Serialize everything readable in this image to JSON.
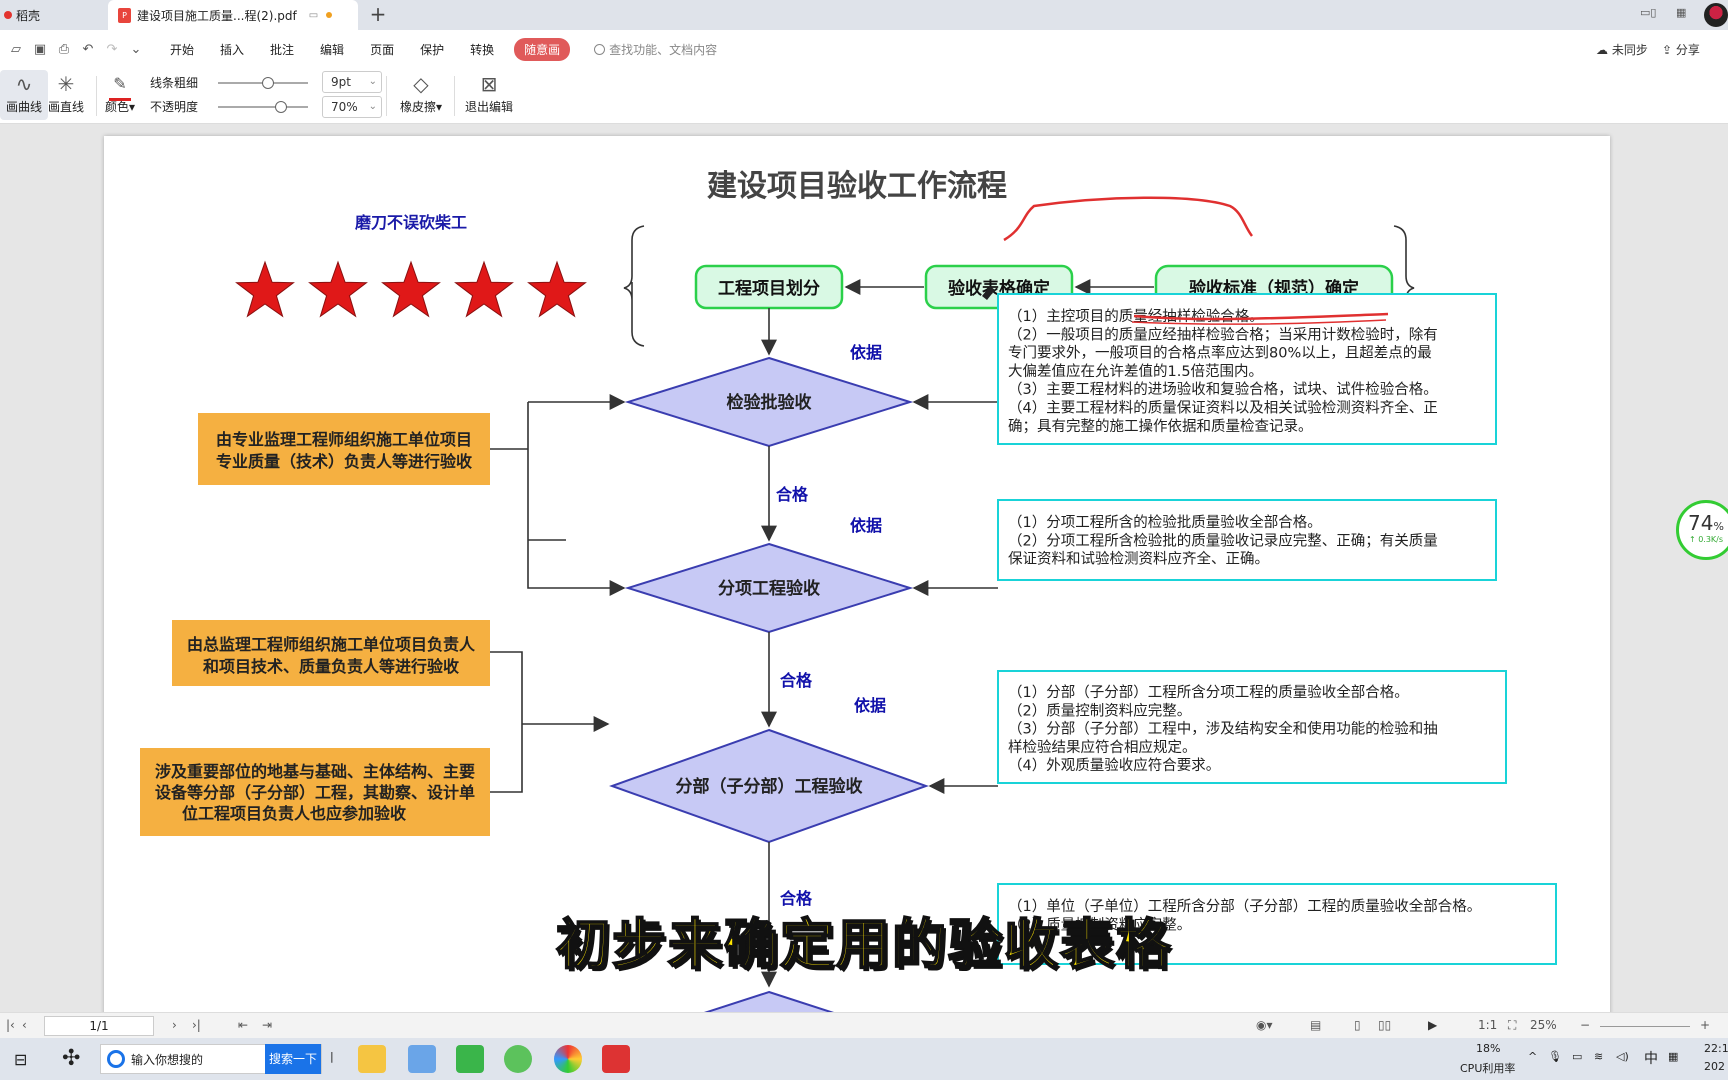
{
  "window": {
    "home_tab": "稻壳",
    "doc_tab": "建设项目施工质量...程(2).pdf",
    "new_tab": "+"
  },
  "menu": {
    "items": [
      "开始",
      "插入",
      "批注",
      "编辑",
      "页面",
      "保护",
      "转换"
    ],
    "active": "随意画",
    "search_placeholder": "查找功能、文档内容",
    "sync": "未同步",
    "share": "分享"
  },
  "drawbar": {
    "curve": "画曲线",
    "line": "画直线",
    "color": "颜色",
    "thickness_label": "线条粗细",
    "thickness_value": "9pt",
    "opacity_label": "不透明度",
    "opacity_value": "70%",
    "thickness_fraction": 0.55,
    "opacity_fraction": 0.7,
    "eraser": "橡皮擦",
    "exit": "退出编辑"
  },
  "diagram": {
    "title": "建设项目验收工作流程",
    "slogan": "磨刀不误砍柴工",
    "star_count": 5,
    "top_boxes": [
      "工程项目划分",
      "验收表格确定",
      "验收标准（规范）确定"
    ],
    "decisions": [
      "检验批验收",
      "分项工程验收",
      "分部（子分部）工程验收"
    ],
    "basis_label": "依据",
    "pass_label": "合格",
    "note_1": [
      "由专业监理工程师组织施工单位项目",
      "专业质量（技术）负责人等进行验收"
    ],
    "note_2": [
      "由总监理工程师组织施工单位项目负责人",
      "和项目技术、质量负责人等进行验收"
    ],
    "note_3": [
      "涉及重要部位的地基与基础、主体结构、主要",
      "设备等分部（子分部）工程，其勘察、设计单",
      "位工程项目负责人也应参加验收"
    ],
    "criteria_1": [
      "（1）主控项目的质量经抽样检验合格。",
      "（2）一般项目的质量应经抽样检验合格；当采用计数检验时，除有",
      "专门要求外，一般项目的合格点率应达到80%以上，且超差点的最",
      "大偏差值应在允许差值的1.5倍范围内。",
      "（3）主要工程材料的进场验收和复验合格，试块、试件检验合格。",
      "（4）主要工程材料的质量保证资料以及相关试验检测资料齐全、正",
      "确；具有完整的施工操作依据和质量检查记录。"
    ],
    "criteria_2": [
      "（1）分项工程所含的检验批质量验收全部合格。",
      "（2）分项工程所含检验批的质量验收记录应完整、正确；有关质量",
      "保证资料和试验检测资料应齐全、正确。"
    ],
    "criteria_3": [
      "（1）分部（子分部）工程所含分项工程的质量验收全部合格。",
      "（2）质量控制资料应完整。",
      "（3）分部（子分部）工程中，涉及结构安全和使用功能的检验和抽",
      "样检验结果应符合相应规定。",
      "（4）外观质量验收应符合要求。"
    ],
    "criteria_4": [
      "（1）单位（子单位）工程所含分部（子分部）工程的质量验收全部合格。",
      "（2）质量控制资料应完整。"
    ]
  },
  "caption": "初步来确定用的验收表格",
  "speed_widget": {
    "percent": "74",
    "unit": "%",
    "rate": "↑ 0.3K/s"
  },
  "statusbar": {
    "page": "1/1",
    "zoom": "25%"
  },
  "taskbar": {
    "search_placeholder": "输入你想搜的",
    "search_button": "搜索一下",
    "cpu_percent": "18%",
    "cpu_label": "CPU利用率",
    "ime": "中",
    "time": "22:1",
    "date": "202"
  },
  "colors": {
    "star": "#e01818",
    "green_box": "#d9f9e4",
    "green_border": "#2bd04a",
    "diamond": "#c7c9f5",
    "diamond_border": "#3a3db0",
    "orange": "#f5b041",
    "cyan_border": "#19d3d8",
    "blue_text": "#1111aa",
    "annotation": "#e03030"
  }
}
